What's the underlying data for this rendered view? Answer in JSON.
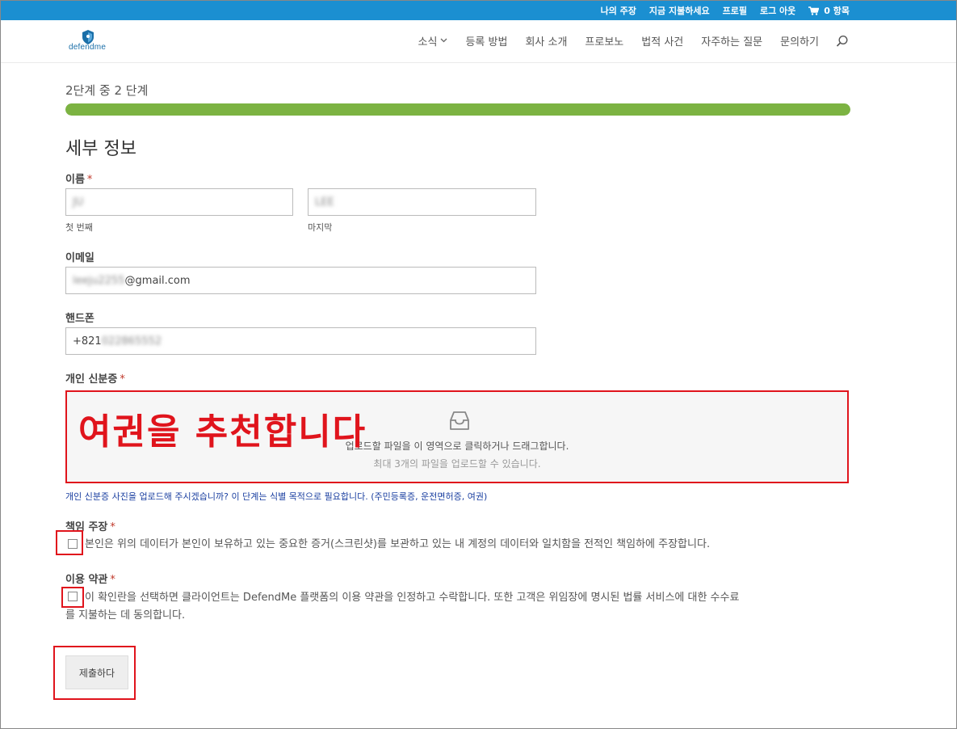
{
  "topbar": {
    "links": [
      "나의 주장",
      "지금 지불하세요",
      "프로필",
      "로그 아웃"
    ],
    "cart_label": "0 항목"
  },
  "header": {
    "logo_text": "defendme",
    "nav": [
      "소식",
      "등록 방법",
      "회사 소개",
      "프로보노",
      "법적 사건",
      "자주하는 질문",
      "문의하기"
    ]
  },
  "form": {
    "step_text": "2단계 중 2 단계",
    "progress_percent": 100,
    "section_title": "세부 정보",
    "name": {
      "label": "이름",
      "first_value": "JU",
      "last_value": "LEE",
      "first_sublabel": "첫 번째",
      "last_sublabel": "마지막"
    },
    "email": {
      "label": "이메일",
      "value_hidden": "leeju2255",
      "value_visible": "@gmail.com"
    },
    "phone": {
      "label": "핸드폰",
      "value_visible": "+821",
      "value_hidden": "022865552"
    },
    "id_card": {
      "label": "개인 신분증",
      "upload_text": "업로드할 파일을 이 영역으로 클릭하거나 드래그합니다.",
      "upload_subtext": "최대 3개의 파일을 업로드할 수 있습니다.",
      "annotation": "여권을 추천합니다",
      "helper": "개인 신분증 사진을 업로드해 주시겠습니까? 이 단계는 식별 목적으로 필요합니다. (주민등록증, 운전면허증, 여권)"
    },
    "claim": {
      "label": "책임 주장",
      "text": "본인은 위의 데이터가 본인이 보유하고 있는 중요한 증거(스크린샷)를 보관하고 있는 내 계정의 데이터와 일치함을 전적인 책임하에 주장합니다."
    },
    "terms": {
      "label": "이용 약관",
      "text_line1": "이 확인란을 선택하면 클라이언트는 DefendMe 플랫폼의 이용 약관을 인정하고 수락합니다. 또한 고객은 위임장에 명시된 법률 서비스에 대한 수수료",
      "text_line2": "를 지불하는 데 동의합니다."
    },
    "submit_label": "제출하다",
    "required_mark": "*"
  },
  "colors": {
    "topbar": "#1b8fd1",
    "progress": "#7cb342",
    "annotation_red": "#e0141c",
    "helper_blue": "#1a3fa0"
  }
}
